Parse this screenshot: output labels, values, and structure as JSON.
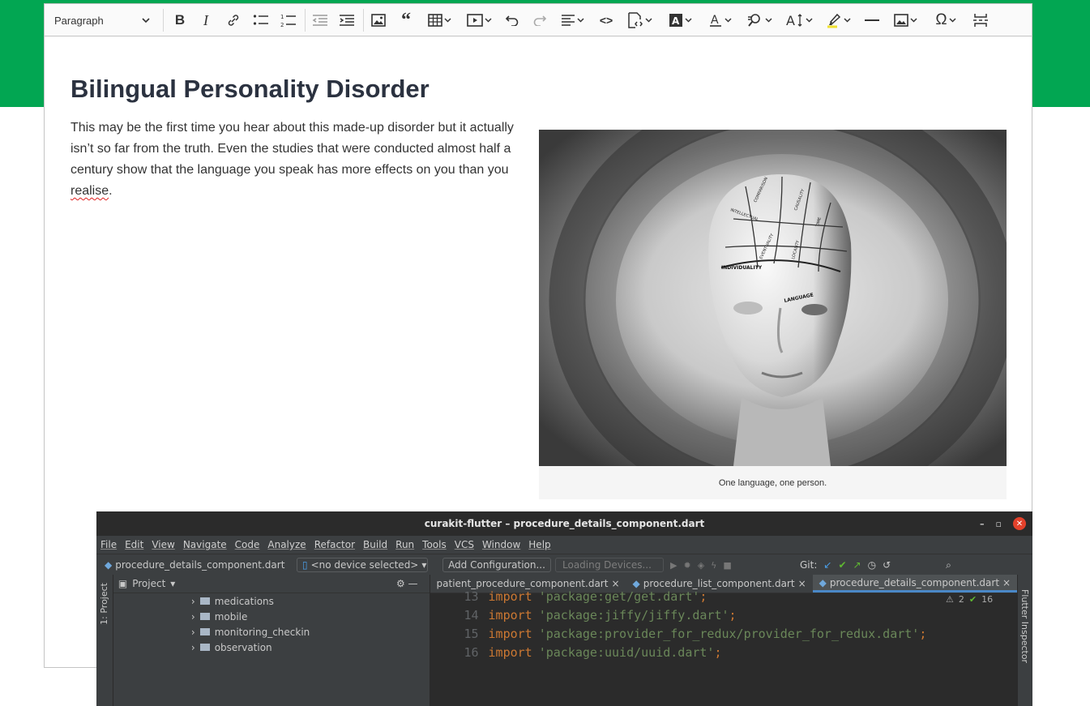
{
  "toolbar": {
    "heading_value": "Paragraph",
    "buttons": [
      "bold",
      "italic",
      "link",
      "bulleted-list",
      "numbered-list",
      "outdent",
      "indent",
      "insert-image",
      "block-quote",
      "insert-table",
      "insert-media",
      "undo",
      "redo",
      "text-alignment",
      "source-editing",
      "code-block",
      "font-background-color",
      "font-color",
      "find-and-replace",
      "font-size",
      "highlight",
      "horizontal-line",
      "image-upload",
      "special-characters",
      "page-break"
    ]
  },
  "article": {
    "title": "Bilingual Personality Disorder",
    "paragraph_before": "This may be the first time you hear about this made-up disorder but it actually isn’t so far from the truth. Even the studies that were conducted almost half a century show that the language you speak has more effects on you than you ",
    "misspelled_word": "realise",
    "paragraph_after": ".",
    "figure_caption": "One language, one person.",
    "photo_words": [
      "INTELLECTUAL",
      "COMPARISON",
      "CAUSALITY",
      "TIME",
      "EVENTUALITY",
      "LOCALITY",
      "INDIVIDUALITY",
      "LANGUAGE"
    ]
  },
  "ide": {
    "title": "curakit-flutter – procedure_details_component.dart",
    "menu": [
      "File",
      "Edit",
      "View",
      "Navigate",
      "Code",
      "Analyze",
      "Refactor",
      "Build",
      "Run",
      "Tools",
      "VCS",
      "Window",
      "Help"
    ],
    "current_file": "procedure_details_component.dart",
    "device": "<no device selected>",
    "add_config": "Add Configuration...",
    "loading": "Loading Devices...",
    "git_label": "Git:",
    "project_label": "Project",
    "side_label": "1: Project",
    "right_label": "Flutter Inspector",
    "tree": [
      "medications",
      "mobile",
      "monitoring_checkin",
      "observation"
    ],
    "tabs": [
      "patient_procedure_component.dart",
      "procedure_list_component.dart",
      "procedure_details_component.dart"
    ],
    "inspections": {
      "warnings": "2",
      "ok": "16"
    },
    "code": [
      {
        "ln": "13",
        "kw": "import",
        "str": "'package:get/get.dart'"
      },
      {
        "ln": "14",
        "kw": "import",
        "str": "'package:jiffy/jiffy.dart'"
      },
      {
        "ln": "15",
        "kw": "import",
        "str": "'package:provider_for_redux/provider_for_redux.dart'"
      },
      {
        "ln": "16",
        "kw": "import",
        "str": "'package:uuid/uuid.dart'"
      }
    ]
  },
  "colors": {
    "brand_green": "#02a652",
    "heading": "#2b3240",
    "close_red": "#e3412b"
  }
}
